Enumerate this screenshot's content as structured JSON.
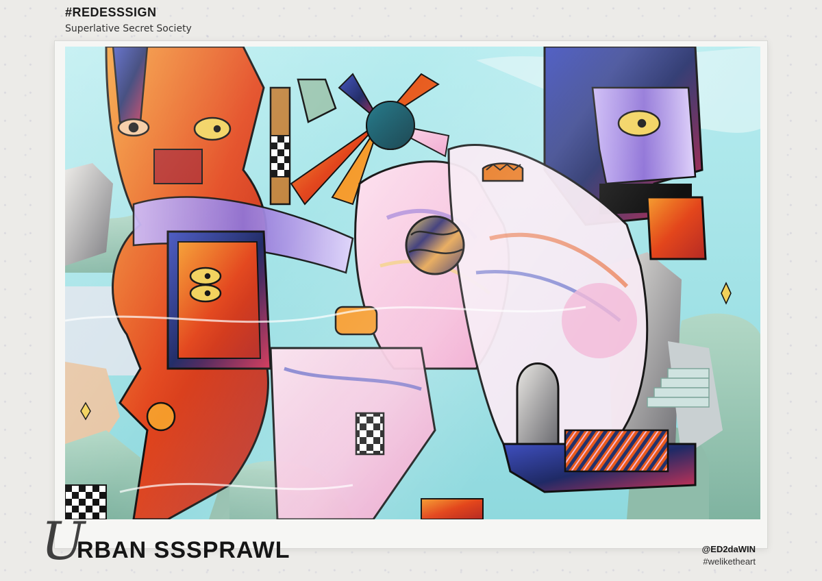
{
  "header": {
    "tag": "#REDESSSIGN",
    "subtitle": "Superlative Secret Society"
  },
  "title": {
    "initial": "U",
    "rest": "RBAN SSSPRAWL"
  },
  "credits": {
    "handle": "@ED2daWIN",
    "hashtag": "#weliketheart"
  },
  "colors": {
    "background": "#ecebe8",
    "sky": "#a7e3e6",
    "orange": "#e85a1c",
    "purple": "#8c6fd6",
    "navy": "#23316b",
    "pink": "#f3b9d8",
    "mint": "#9cc7b2",
    "yellow": "#f2d15a"
  }
}
